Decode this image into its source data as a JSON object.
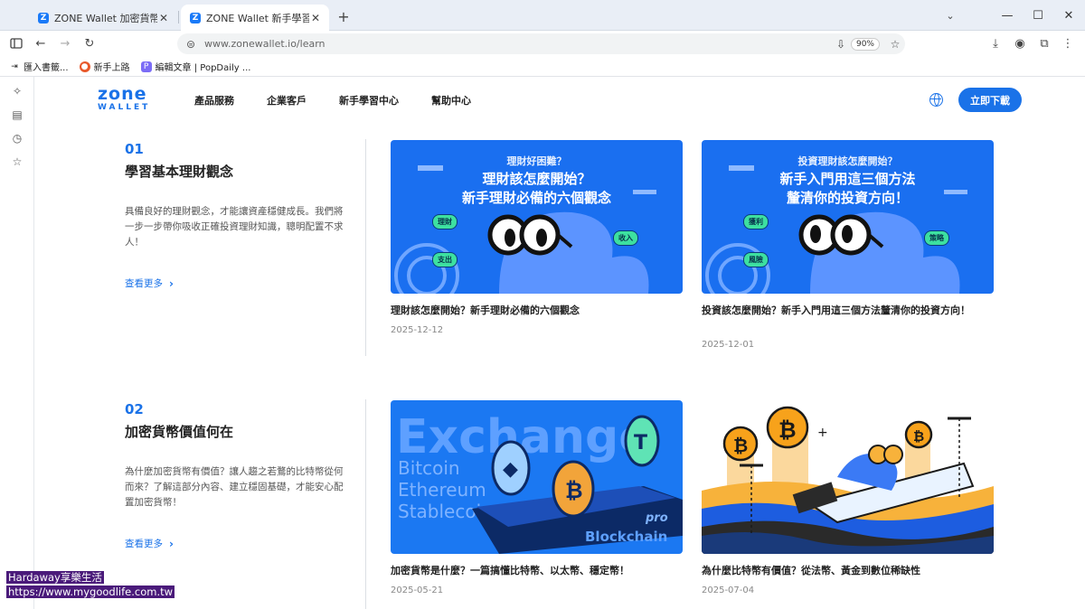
{
  "browser": {
    "tabs": [
      {
        "title": "ZONE Wallet 加密貨幣交易所 |",
        "active": false
      },
      {
        "title": "ZONE Wallet 新手學習中心",
        "active": true
      }
    ],
    "url": "www.zonewallet.io/learn",
    "zoom": "90%",
    "bookmarks": [
      {
        "label": "匯入書籤..."
      },
      {
        "label": "新手上路"
      },
      {
        "label": "編輯文章 | PopDaily ..."
      }
    ]
  },
  "site": {
    "logo_top": "zone",
    "logo_bottom": "WALLET",
    "nav": [
      "產品服務",
      "企業客戶",
      "新手學習中心",
      "幫助中心"
    ],
    "download_label": "立即下載",
    "brand_color": "#1a72e8"
  },
  "sections": [
    {
      "num": "01",
      "title": "學習基本理財觀念",
      "desc": "具備良好的理財觀念，才能讓資產穩健成長。我們將一步一步帶你吸收正確投資理財知識，聰明配置不求人！",
      "more": "查看更多",
      "cards": [
        {
          "thumb_small": "理財好困難？",
          "thumb_big_1": "理財該怎麼開始？",
          "thumb_big_2": "新手理財必備的六個觀念",
          "pills": [
            "理財",
            "支出",
            "收入"
          ],
          "title": "理財該怎麼開始？新手理財必備的六個觀念",
          "date": "2025-12-12"
        },
        {
          "thumb_small": "投資理財該怎麼開始？",
          "thumb_big_1": "新手入門用這三個方法",
          "thumb_big_2": "釐清你的投資方向！",
          "pills": [
            "獲利",
            "風險",
            "策略"
          ],
          "title": "投資該怎麼開始？新手入門用這三個方法釐清你的投資方向！",
          "date": "2025-12-01"
        }
      ]
    },
    {
      "num": "02",
      "title": "加密貨幣價值何在",
      "desc": "為什麼加密貨幣有價值？讓人趨之若鶩的比特幣從何而來？了解這部分內容、建立穩固基礎，才能安心配置加密貨幣！",
      "more": "查看更多",
      "cards": [
        {
          "thumb_words": [
            "Exchange",
            "Bitcoin",
            "Ethereum",
            "Stablecoin",
            "pro",
            "Blockchain"
          ],
          "title": "加密貨幣是什麼？一篇搞懂比特幣、以太幣、穩定幣！",
          "date": "2025-05-21"
        },
        {
          "title": "為什麼比特幣有價值？從法幣、黃金到數位稀缺性",
          "date": "2025-07-04"
        }
      ]
    }
  ],
  "watermark": {
    "line1": "Hardaway享樂生活",
    "line2": "https://www.mygoodlife.com.tw"
  }
}
